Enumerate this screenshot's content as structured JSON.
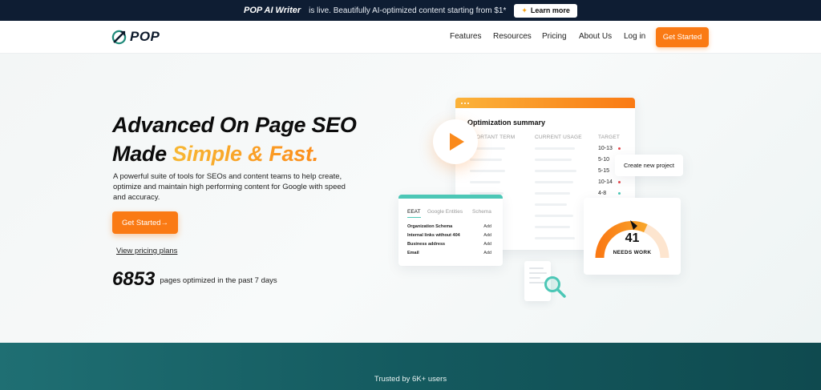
{
  "announcement": {
    "brand": "POP AI Writer",
    "message": "is live. Beautifully AI-optimized content starting from $1*",
    "button_label": "Learn more"
  },
  "nav": {
    "logo_text": "POP",
    "links": [
      "Features",
      "Resources",
      "Pricing",
      "About Us",
      "Log in"
    ],
    "cta_label": "Get Started"
  },
  "hero": {
    "headline_line1": "Advanced On Page SEO",
    "headline_line2_prefix": "Made ",
    "headline_line2_accent": "Simple & Fast.",
    "description": "A powerful suite of tools for SEOs and content teams to help create, optimize and maintain high performing content for Google with speed and accuracy.",
    "cta_label": "Get Started→",
    "pricing_link": "View pricing plans",
    "counter_value": "6853",
    "counter_label": "pages optimized in the past 7 days"
  },
  "illustration": {
    "summary_title": "Optimization summary",
    "columns": [
      "ORTANT TERM",
      "CURRENT USAGE",
      "TARGET"
    ],
    "targets": [
      {
        "label": "10-13",
        "dot": "#e5484d"
      },
      {
        "label": "5-10",
        "dot": ""
      },
      {
        "label": "5-15",
        "dot": ""
      },
      {
        "label": "10-14",
        "dot": "#e5484d"
      },
      {
        "label": "4-8",
        "dot": "#4cc7b6"
      }
    ],
    "new_project_label": "Create new project",
    "eeat_tabs": [
      "EEAT",
      "Google Entities",
      "Schema"
    ],
    "eeat_rows": [
      {
        "label": "Organization Schema",
        "action": "Add"
      },
      {
        "label": "Internal links without 404",
        "action": "Add"
      },
      {
        "label": "Business address",
        "action": "Add"
      },
      {
        "label": "Email",
        "action": "Add"
      }
    ],
    "gauge_value": "41",
    "gauge_label": "NEEDS WORK",
    "gauge_level": 0.41
  },
  "footer_band": {
    "trusted_text": "Trusted by 6K+ users"
  },
  "colors": {
    "accent_orange": "#fa7a14",
    "accent_yellow": "#f7b733",
    "teal": "#4cc7b6",
    "navy": "#0e1d33",
    "band_teal": "#145a5f"
  }
}
